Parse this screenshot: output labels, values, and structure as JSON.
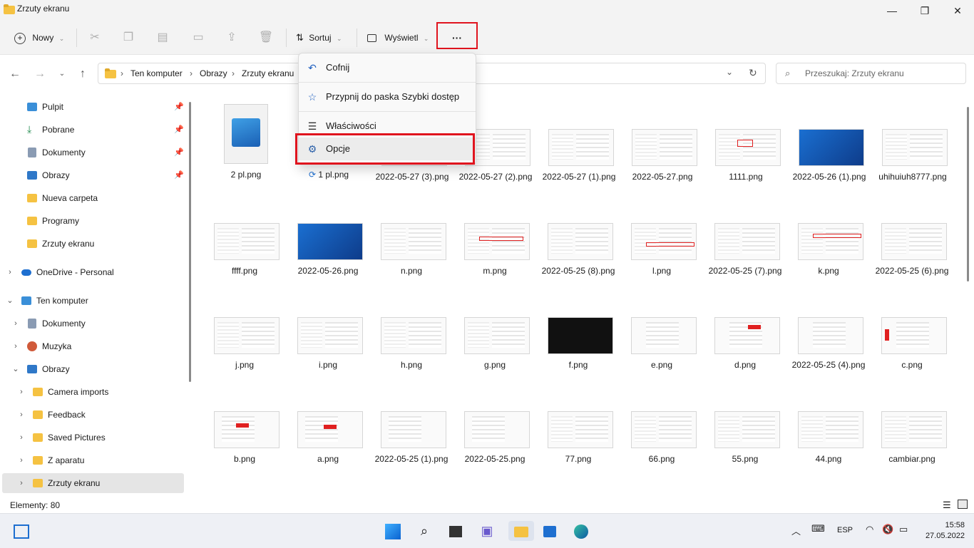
{
  "window": {
    "title": "Zrzuty ekranu",
    "min": "—",
    "max": "❐",
    "close": "✕"
  },
  "toolbar": {
    "new_label": "Nowy",
    "sort_label": "Sortuj",
    "view_label": "Wyświetl",
    "more_label": "···"
  },
  "address": {
    "crumbs": [
      "Ten komputer",
      "Obrazy",
      "Zrzuty ekranu"
    ],
    "search_placeholder": "Przeszukaj: Zrzuty ekranu"
  },
  "menu": {
    "items": [
      {
        "label": "Cofnij",
        "icon": "undo-icon"
      },
      {
        "label": "Przypnij do paska Szybki dostęp",
        "icon": "star-icon"
      },
      {
        "label": "Właściwości",
        "icon": "properties-icon"
      },
      {
        "label": "Opcje",
        "icon": "folder-options-icon"
      }
    ]
  },
  "sidebar": {
    "quick": [
      {
        "label": "Pulpit",
        "pinned": true,
        "icon": "desktop-icon"
      },
      {
        "label": "Pobrane",
        "pinned": true,
        "icon": "download-icon"
      },
      {
        "label": "Dokumenty",
        "pinned": true,
        "icon": "documents-icon"
      },
      {
        "label": "Obrazy",
        "pinned": true,
        "icon": "pictures-icon"
      },
      {
        "label": "Nueva carpeta",
        "pinned": false,
        "icon": "folder-icon"
      },
      {
        "label": "Programy",
        "pinned": false,
        "icon": "folder-icon"
      },
      {
        "label": "Zrzuty ekranu",
        "pinned": false,
        "icon": "folder-icon"
      }
    ],
    "onedrive": "OneDrive - Personal",
    "thispc": "Ten komputer",
    "pc_items": [
      "Dokumenty",
      "Muzyka",
      "Obrazy"
    ],
    "pictures_items": [
      "Camera imports",
      "Feedback",
      "Saved Pictures",
      "Z aparatu",
      "Zrzuty ekranu"
    ]
  },
  "files": {
    "row1": [
      "2 pl.png",
      "1 pl.png",
      "2022-05-27 (3).png",
      "2022-05-27 (2).png",
      "2022-05-27 (1).png",
      "2022-05-27.png",
      "1111.png",
      "2022-05-26 (1).png",
      "uhihuiuh8777.png"
    ],
    "row2": [
      "ffff.png",
      "2022-05-26.png",
      "n.png",
      "m.png",
      "2022-05-25 (8).png",
      "l.png",
      "2022-05-25 (7).png",
      "k.png",
      "2022-05-25 (6).png"
    ],
    "row3": [
      "j.png",
      "i.png",
      "h.png",
      "g.png",
      "f.png",
      "e.png",
      "d.png",
      "2022-05-25 (4).png",
      "c.png"
    ],
    "row4": [
      "b.png",
      "a.png",
      "2022-05-25 (1).png",
      "2022-05-25.png",
      "77.png",
      "66.png",
      "55.png",
      "44.png",
      "cambiar.png"
    ]
  },
  "status": {
    "count": "Elementy: 80"
  },
  "taskbar": {
    "lang": "ESP",
    "time": "15:58",
    "date": "27.05.2022"
  }
}
